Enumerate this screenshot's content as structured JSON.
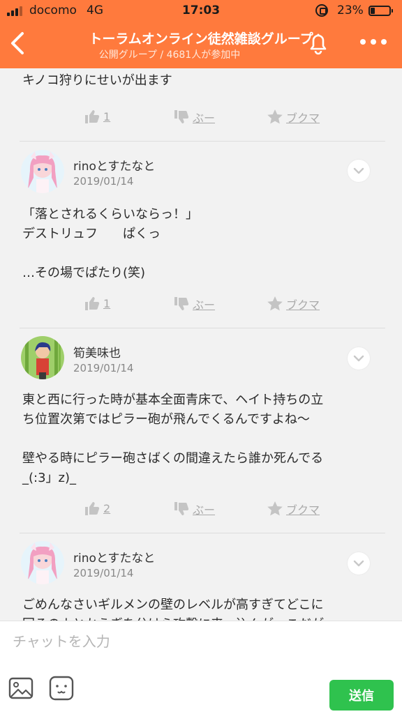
{
  "status_bar": {
    "carrier": "docomo",
    "network": "4G",
    "time": "17:03",
    "battery_text": "23%",
    "battery_level": 0.23,
    "signal_bars_on": 3,
    "signal_bars_total": 4
  },
  "header": {
    "title": "トーラムオンライン徒然雑談グループ",
    "subtitle": "公開グループ / 4681人が参加中",
    "color": "#ff7a3d"
  },
  "actions_labels": {
    "bad": "ぶー",
    "bookmark": "ブクマ"
  },
  "messages": [
    {
      "text": "キノコ狩りにせいが出ます",
      "likes": "1"
    },
    {
      "author": "rinoとすたなと",
      "date": "2019/01/14",
      "text": "「落とされるくらいならっ！」\nデストリュフ　　ぱくっ\n\n…その場でぱたり(笑)",
      "likes": "1"
    },
    {
      "author": "筍美味也",
      "date": "2019/01/14",
      "text": "東と西に行った時が基本全面青床で、ヘイト持ちの立\nち位置次第ではピラー砲が飛んでくるんですよね〜\n\n壁やる時にピラー砲さばくの間違えたら誰か死んでる\n_(:3」z)_",
      "likes": "2"
    },
    {
      "author": "rinoとすたなと",
      "date": "2019/01/14",
      "text": "ごめんなさいギルメンの壁のレベルが高すぎてどこに\n回るのよとかうぎを分けら攻撃に来…込んが…こだが"
    }
  ],
  "input": {
    "placeholder": "チャットを入力",
    "send_label": "送信",
    "send_color": "#2fc24e"
  },
  "icons": {
    "back": "back-chevron-icon",
    "bell": "bell-icon",
    "more": "more-dots-icon",
    "like": "thumbs-up-icon",
    "bad": "thumbs-down-icon",
    "bookmark": "star-icon",
    "expand": "expand-arrows-icon",
    "image": "image-icon",
    "sticker": "sticker-face-icon"
  }
}
